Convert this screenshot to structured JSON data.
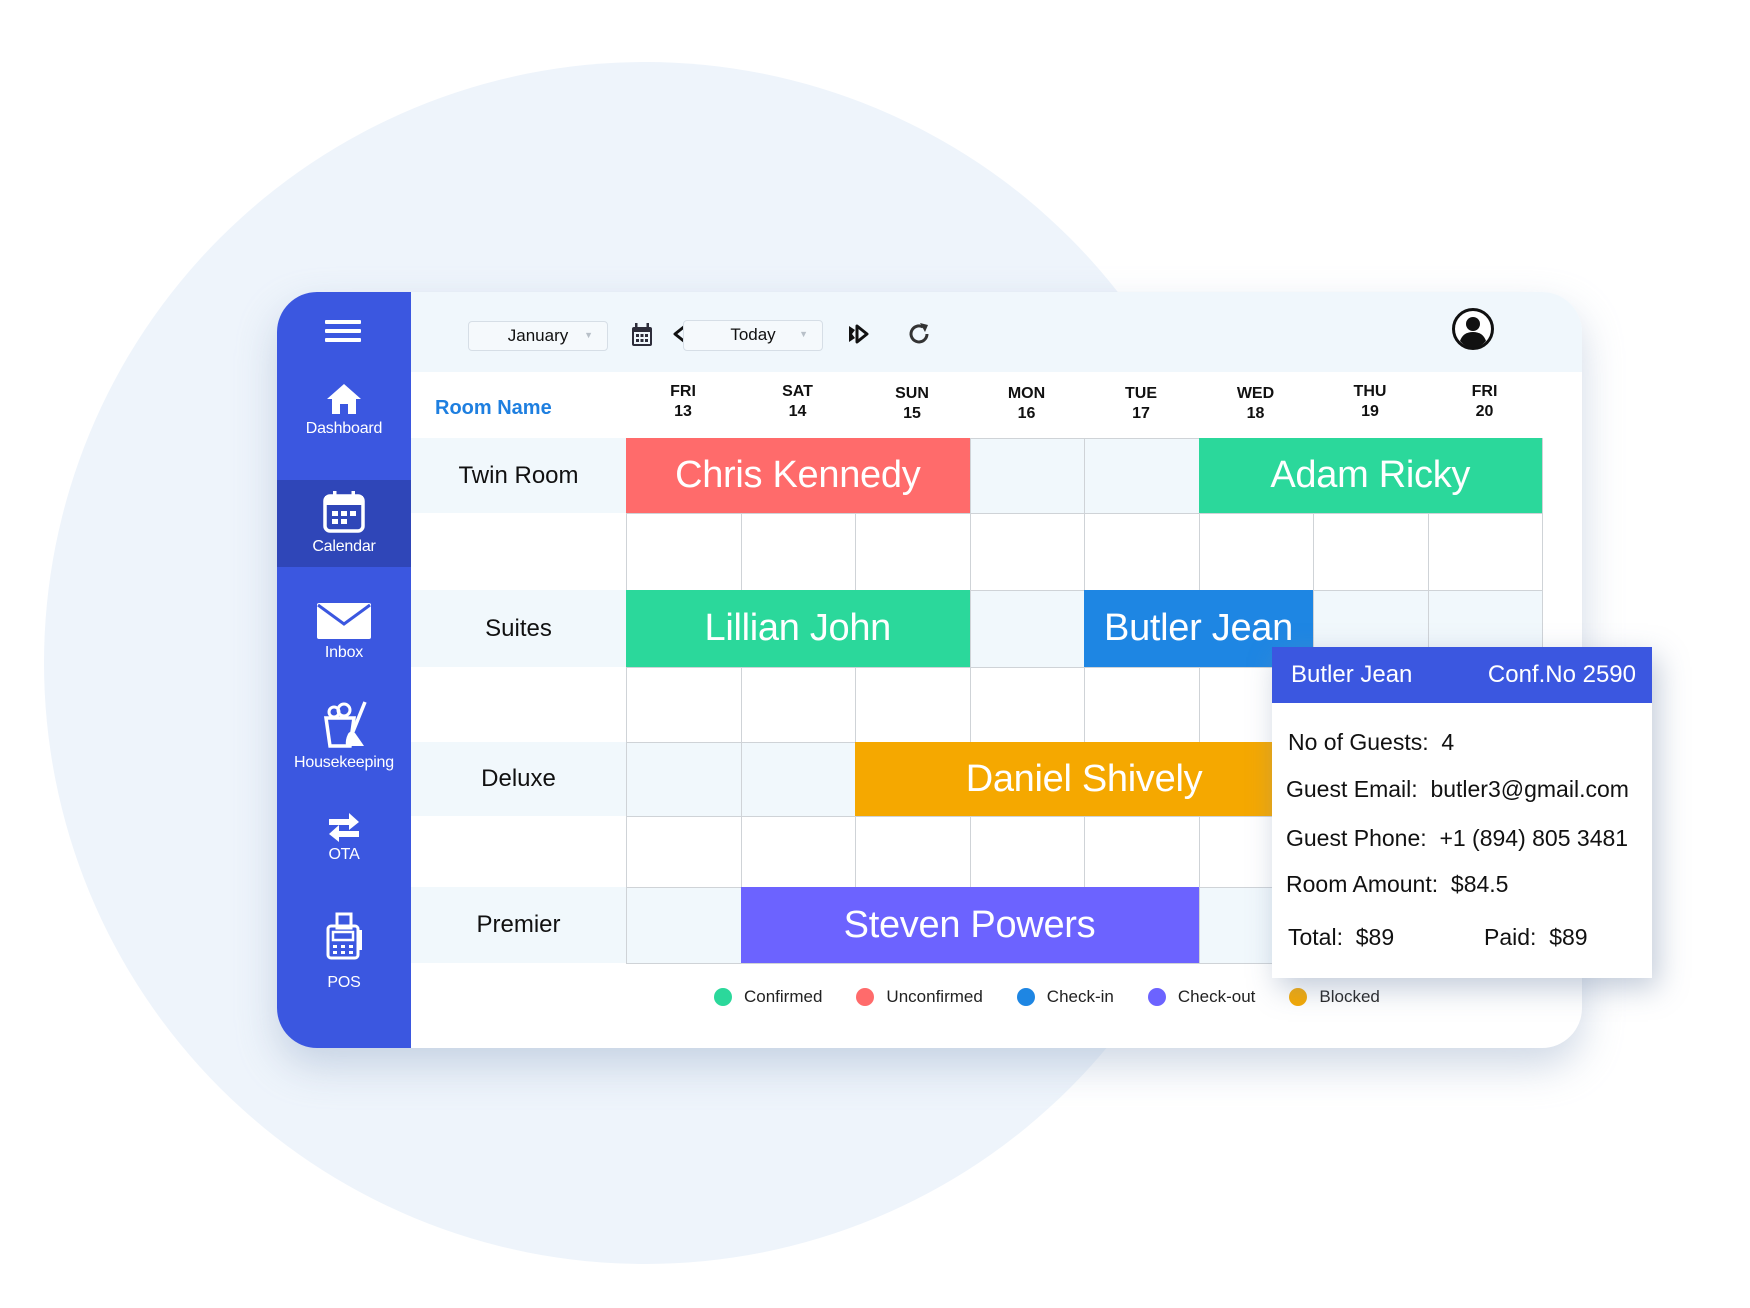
{
  "sidebar": {
    "items": [
      {
        "label": "Dashboard",
        "icon": "home-icon"
      },
      {
        "label": "Calendar",
        "icon": "calendar-icon",
        "active": true
      },
      {
        "label": "Inbox",
        "icon": "envelope-icon"
      },
      {
        "label": "Housekeeping",
        "icon": "bucket-broom-icon"
      },
      {
        "label": "OTA",
        "icon": "swap-arrows-icon"
      },
      {
        "label": "POS",
        "icon": "cash-register-icon"
      }
    ]
  },
  "toolbar": {
    "month_select": "January",
    "view_select": "Today"
  },
  "calendar": {
    "room_header": "Room Name",
    "days": [
      {
        "dow": "FRI",
        "date": "13"
      },
      {
        "dow": "SAT",
        "date": "14"
      },
      {
        "dow": "SUN",
        "date": "15"
      },
      {
        "dow": "MON",
        "date": "16"
      },
      {
        "dow": "TUE",
        "date": "17"
      },
      {
        "dow": "WED",
        "date": "18"
      },
      {
        "dow": "THU",
        "date": "19"
      },
      {
        "dow": "FRI",
        "date": "20"
      }
    ],
    "rooms": [
      "Twin Room",
      "Suites",
      "Deluxe",
      "Premier"
    ],
    "bookings": [
      {
        "guest": "Chris Kennedy",
        "room": "Twin Room",
        "status": "Unconfirmed"
      },
      {
        "guest": "Adam Ricky",
        "room": "Twin Room",
        "status": "Confirmed"
      },
      {
        "guest": "Lillian John",
        "room": "Suites",
        "status": "Confirmed"
      },
      {
        "guest": "Butler Jean",
        "room": "Suites",
        "status": "Check-in"
      },
      {
        "guest": "Daniel Shively",
        "room": "Deluxe",
        "status": "Blocked"
      },
      {
        "guest": "Steven Powers",
        "room": "Premier",
        "status": "Check-out"
      }
    ]
  },
  "legend": [
    {
      "label": "Confirmed",
      "color": "#2bd89b"
    },
    {
      "label": "Unconfirmed",
      "color": "#ff6b6b"
    },
    {
      "label": "Check-in",
      "color": "#1e86e3"
    },
    {
      "label": "Check-out",
      "color": "#6c63ff"
    },
    {
      "label": "Blocked",
      "color": "#f5a800"
    }
  ],
  "popup": {
    "guest": "Butler Jean",
    "conf": "Conf.No 2590",
    "guests_label": "No of Guests:",
    "guests_value": "4",
    "email_label": "Guest Email:",
    "email_value": "butler3@gmail.com",
    "phone_label": "Guest Phone:",
    "phone_value": "+1 (894) 805 3481",
    "amount_label": "Room Amount:",
    "amount_value": "$84.5",
    "total_label": "Total:",
    "total_value": "$89",
    "paid_label": "Paid:",
    "paid_value": "$89"
  }
}
